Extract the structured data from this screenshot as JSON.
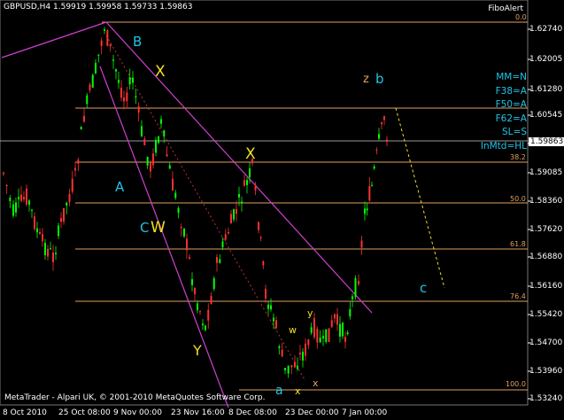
{
  "header": {
    "symbol_info": "GBPUSD,H4  1.59919 1.59958 1.59733 1.59863"
  },
  "indicator": {
    "name": "FiboAlert"
  },
  "params": [
    "MM=N",
    "F38=A",
    "F50=A",
    "F62=A",
    "SL=S",
    "InMtd=HL"
  ],
  "current_price": "1.59863",
  "y_ticks": [
    "1.62740",
    "1.62005",
    "1.61280",
    "1.60545",
    "1.59820",
    "1.59085",
    "1.58360",
    "1.57620",
    "1.56880",
    "1.56160",
    "1.55420",
    "1.54700",
    "1.53960",
    "1.53240"
  ],
  "x_ticks": [
    "8 Oct 2010",
    "25 Oct 08:00",
    "9 Nov 00:00",
    "23 Nov 16:00",
    "8 Dec 08:00",
    "23 Dec 00:00",
    "7 Jan 00:00"
  ],
  "fib_levels": [
    "0.0",
    "38.2",
    "50.0",
    "61.8",
    "76.4",
    "100.0"
  ],
  "waves": {
    "B": "B",
    "X1": "X",
    "A": "A",
    "CW_C": "C",
    "CW_W": "W",
    "X2": "X",
    "Y": "Y",
    "w": "w",
    "y": "y",
    "a": "a",
    "x1": "x",
    "x2": "x",
    "z": "z",
    "b": "b",
    "c": "c"
  },
  "copyright": "MetaTrader - Alpari UK, © 2001-2010 MetaQuotes Software Corp.",
  "colors": {
    "bull": "#00ff00",
    "bear": "#ff3030",
    "fib": "#e0a060",
    "channel": "#d040d0",
    "wave_yellow": "#f0e020",
    "wave_cyan": "#22c3e6"
  }
}
